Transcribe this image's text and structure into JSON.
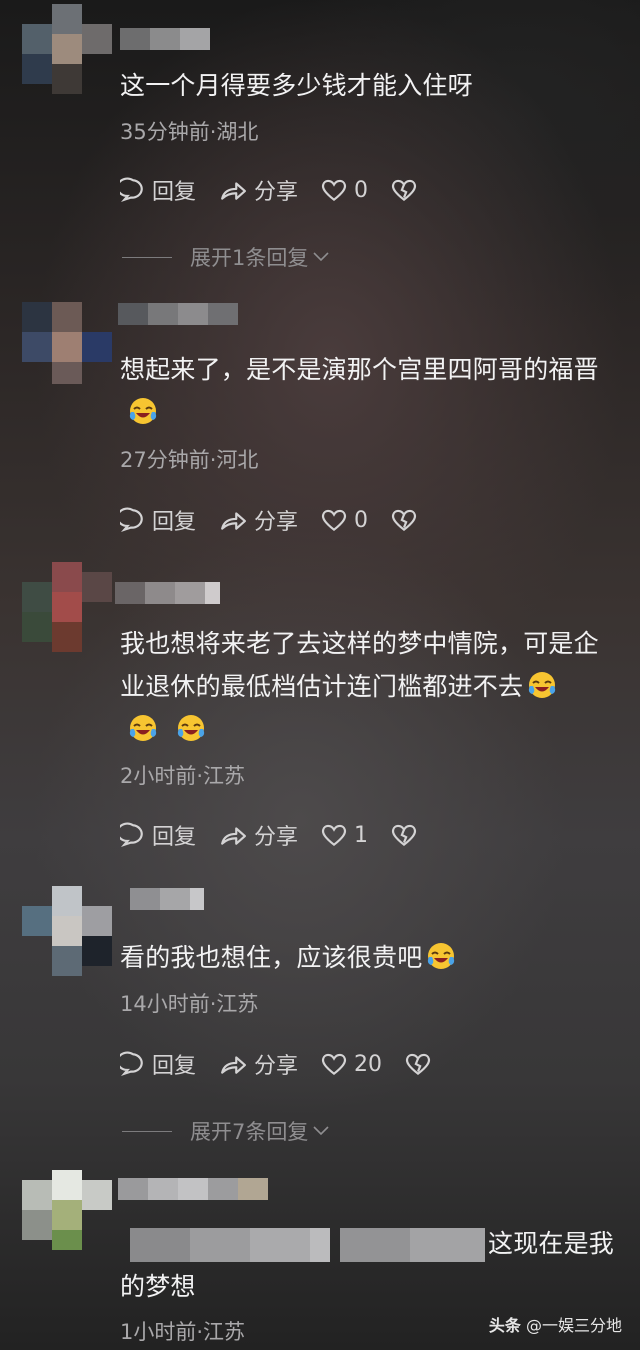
{
  "comments": [
    {
      "text": "这一个月得要多少钱才能入住呀",
      "meta": "35分钟前·湖北",
      "reply_label": "回复",
      "share_label": "分享",
      "likes": "0",
      "expand_label": "展开1条回复"
    },
    {
      "text": "想起来了，是不是演那个宫里四阿哥的福晋",
      "meta": "27分钟前·河北",
      "reply_label": "回复",
      "share_label": "分享",
      "likes": "0"
    },
    {
      "text_line1": "我也想将来老了去这样的梦中情院，可是企",
      "text_line2": "业退休的最低档估计连门槛都进不去",
      "meta": "2小时前·江苏",
      "reply_label": "回复",
      "share_label": "分享",
      "likes": "1"
    },
    {
      "text": "看的我也想住，应该很贵吧",
      "meta": "14小时前·江苏",
      "reply_label": "回复",
      "share_label": "分享",
      "likes": "20",
      "expand_label": "展开7条回复"
    },
    {
      "text_tail": "这现在是我",
      "text_line2": "的梦想",
      "meta": "1小时前·江苏"
    }
  ],
  "emoji": "crying-laughing-emoji",
  "watermark": {
    "site": "头条",
    "handle": "@一娱三分地"
  },
  "colors": {
    "text_primary": "#f2f2f3",
    "text_meta": "#a9a8aa",
    "text_action": "#d4d3d4",
    "emoji_face": "#f7c531",
    "emoji_tear": "#4aa3e8"
  }
}
